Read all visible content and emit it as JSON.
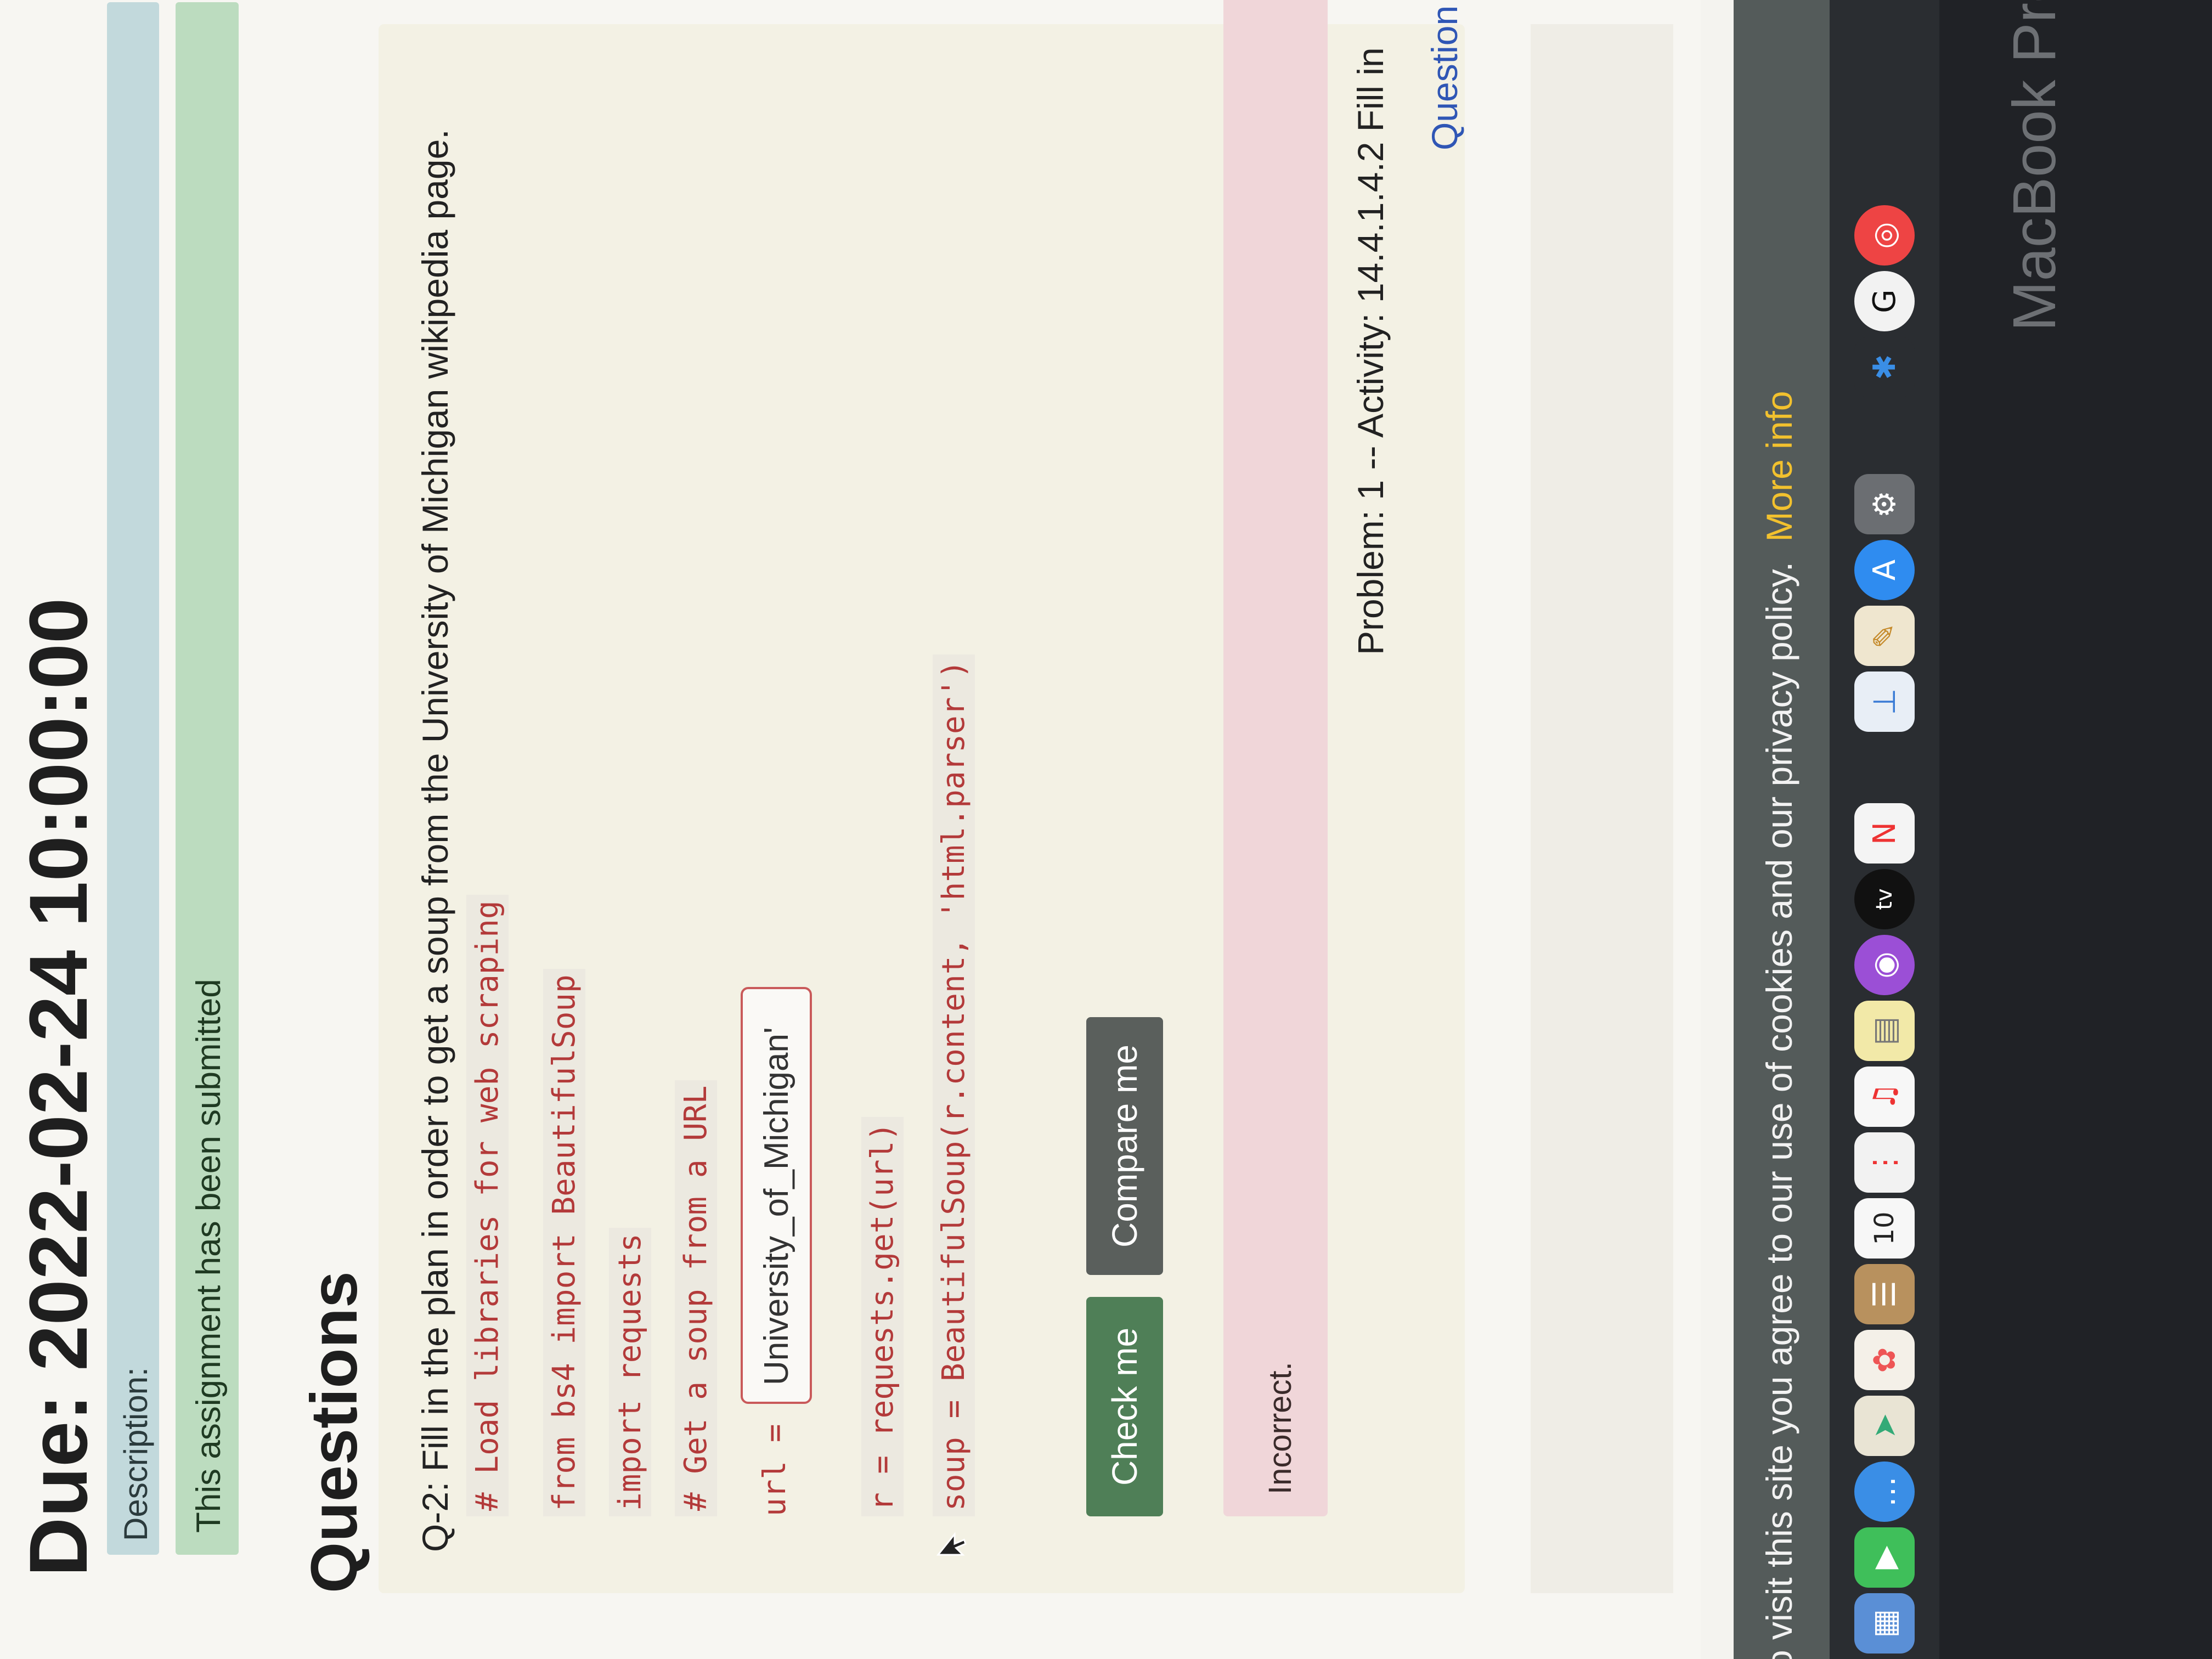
{
  "header": {
    "due": "Due: 2022-02-24 10:00:00",
    "description_label": "Description:",
    "submitted_notice": "This assignment has been submitted"
  },
  "questions_heading": "Questions",
  "question": {
    "prompt": "Q-2: Fill in the plan in order to get a soup from the University of Michigan wikipedia page.",
    "code": {
      "line1": "# Load libraries for web scraping",
      "line2": "from bs4 import BeautifulSoup",
      "line3": "import requests",
      "line4": "# Get a soup from a URL",
      "url_label": "url =",
      "url_input_value": "University_of_Michigan'",
      "line6": "r = requests.get(url)",
      "line7": "soup = BeautifulSoup(r.content, 'html.parser')"
    },
    "check_button": "Check me",
    "compare_button": "Compare me",
    "feedback": "Incorrect.",
    "problem_info": "Problem: 1 -- Activity: 14.4.1.4.2 Fill in",
    "context_link": "Question in Contex"
  },
  "cookie_bar": {
    "text": "o visit this site you agree to our use of cookies and our privacy policy.",
    "link": "More info"
  },
  "dock": {
    "badges": [
      "10",
      "tv"
    ]
  },
  "hardware_label": "MacBook Pro",
  "colors": {
    "submitted_green": "#bcdcbf",
    "description_blue": "#c2d9dc",
    "check_button": "#4f7f57",
    "compare_button": "#5a5f5c",
    "incorrect_pink": "#f0d6d9",
    "link_blue": "#2f56b5",
    "cookie_link_yellow": "#f2c12e"
  }
}
